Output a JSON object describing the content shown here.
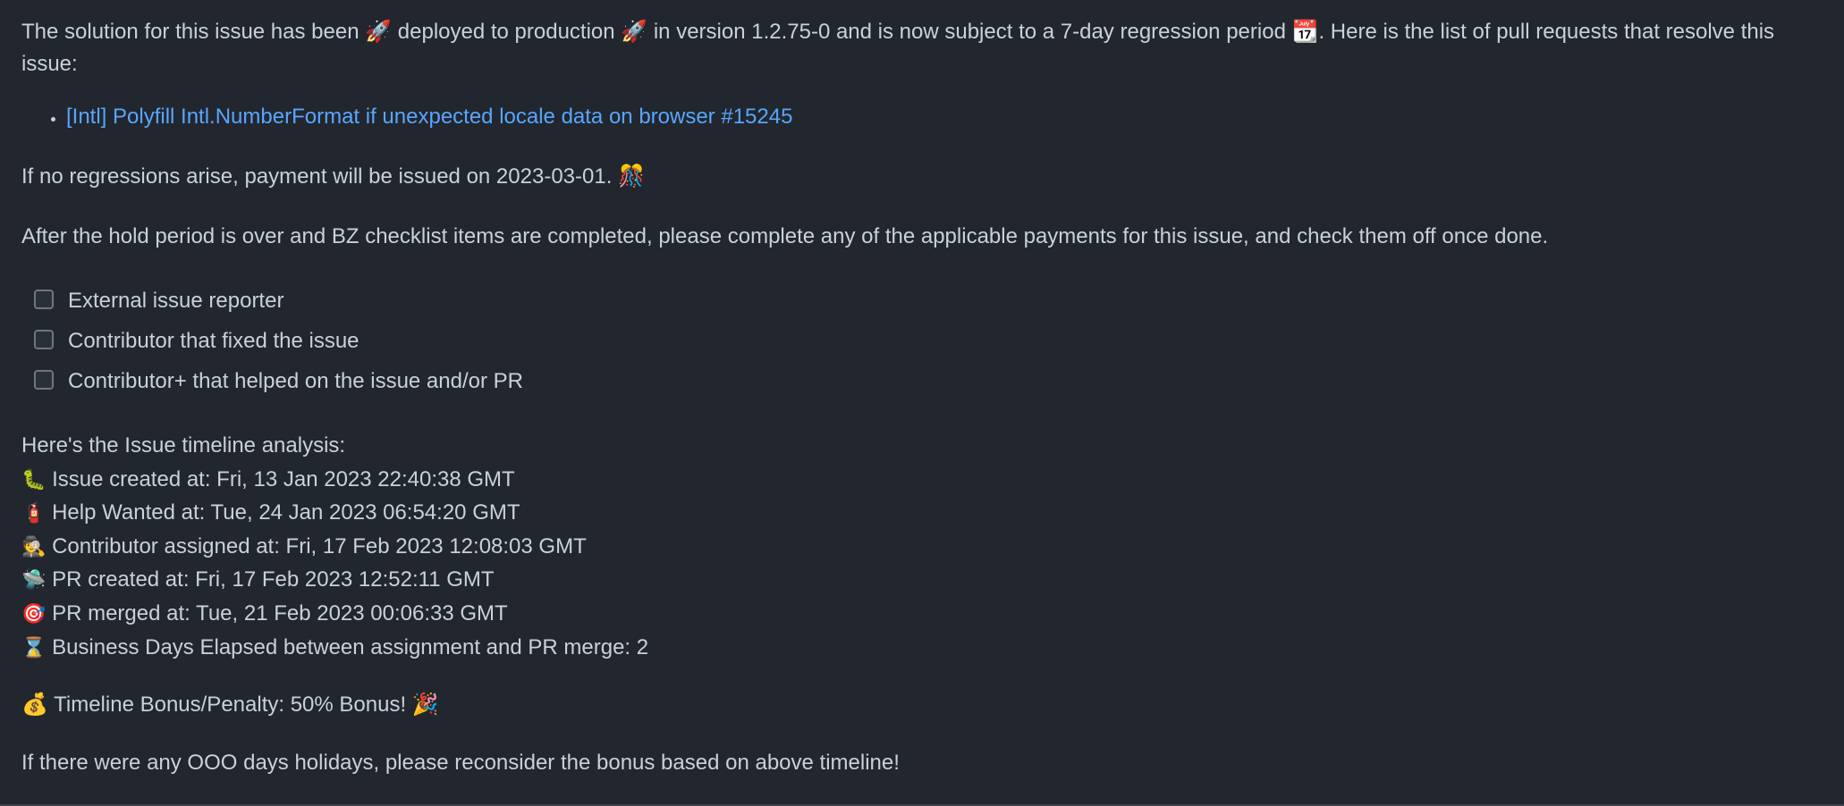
{
  "comment": {
    "intro": "The solution for this issue has been 🚀 deployed to production 🚀 in version 1.2.75-0 and is now subject to a 7-day regression period 📆. Here is the list of pull requests that resolve this issue:",
    "pull_requests": [
      {
        "label": "[Intl] Polyfill Intl.NumberFormat if unexpected locale data on browser #15245"
      }
    ],
    "payment_note": "If no regressions arise, payment will be issued on 2023-03-01. 🎊",
    "hold_note": "After the hold period is over and BZ checklist items are completed, please complete any of the applicable payments for this issue, and check them off once done.",
    "checklist": [
      {
        "label": "External issue reporter",
        "checked": false
      },
      {
        "label": "Contributor that fixed the issue",
        "checked": false
      },
      {
        "label": "Contributor+ that helped on the issue and/or PR",
        "checked": false
      }
    ],
    "timeline_heading": "Here's the Issue timeline analysis:",
    "timeline": [
      {
        "icon": "🐛",
        "text": "Issue created at: Fri, 13 Jan 2023 22:40:38 GMT"
      },
      {
        "icon": "🧯",
        "text": "Help Wanted at: Tue, 24 Jan 2023 06:54:20 GMT"
      },
      {
        "icon": "🕵",
        "text": "Contributor assigned at: Fri, 17 Feb 2023 12:08:03 GMT"
      },
      {
        "icon": "🛸",
        "text": "PR created at: Fri, 17 Feb 2023 12:52:11 GMT"
      },
      {
        "icon": "🎯",
        "text": "PR merged at: Tue, 21 Feb 2023 00:06:33 GMT"
      },
      {
        "icon": "⌛",
        "text": "Business Days Elapsed between assignment and PR merge: 2"
      }
    ],
    "bonus": "💰 Timeline Bonus/Penalty: 50% Bonus! 🎉",
    "ooo_note": "If there were any OOO days holidays, please reconsider the bonus based on above timeline!"
  },
  "colors": {
    "background": "#22262e",
    "text": "#c9d1d9",
    "link": "#58a6ff"
  }
}
